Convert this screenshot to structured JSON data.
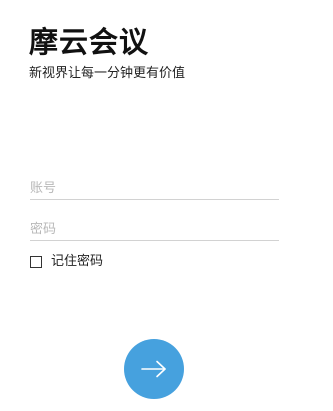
{
  "app": {
    "title": "摩云会议",
    "slogan": "新视界让每一分钟更有价值"
  },
  "login_form": {
    "account_placeholder": "账号",
    "account_value": "",
    "password_placeholder": "密码",
    "password_value": "",
    "remember_label": "记住密码",
    "remember_checked": false,
    "submit_icon": "arrow-right-icon"
  },
  "colors": {
    "accent": "#46a1de",
    "field_underline": "#d2d2d2",
    "placeholder": "#b8b8b8"
  }
}
